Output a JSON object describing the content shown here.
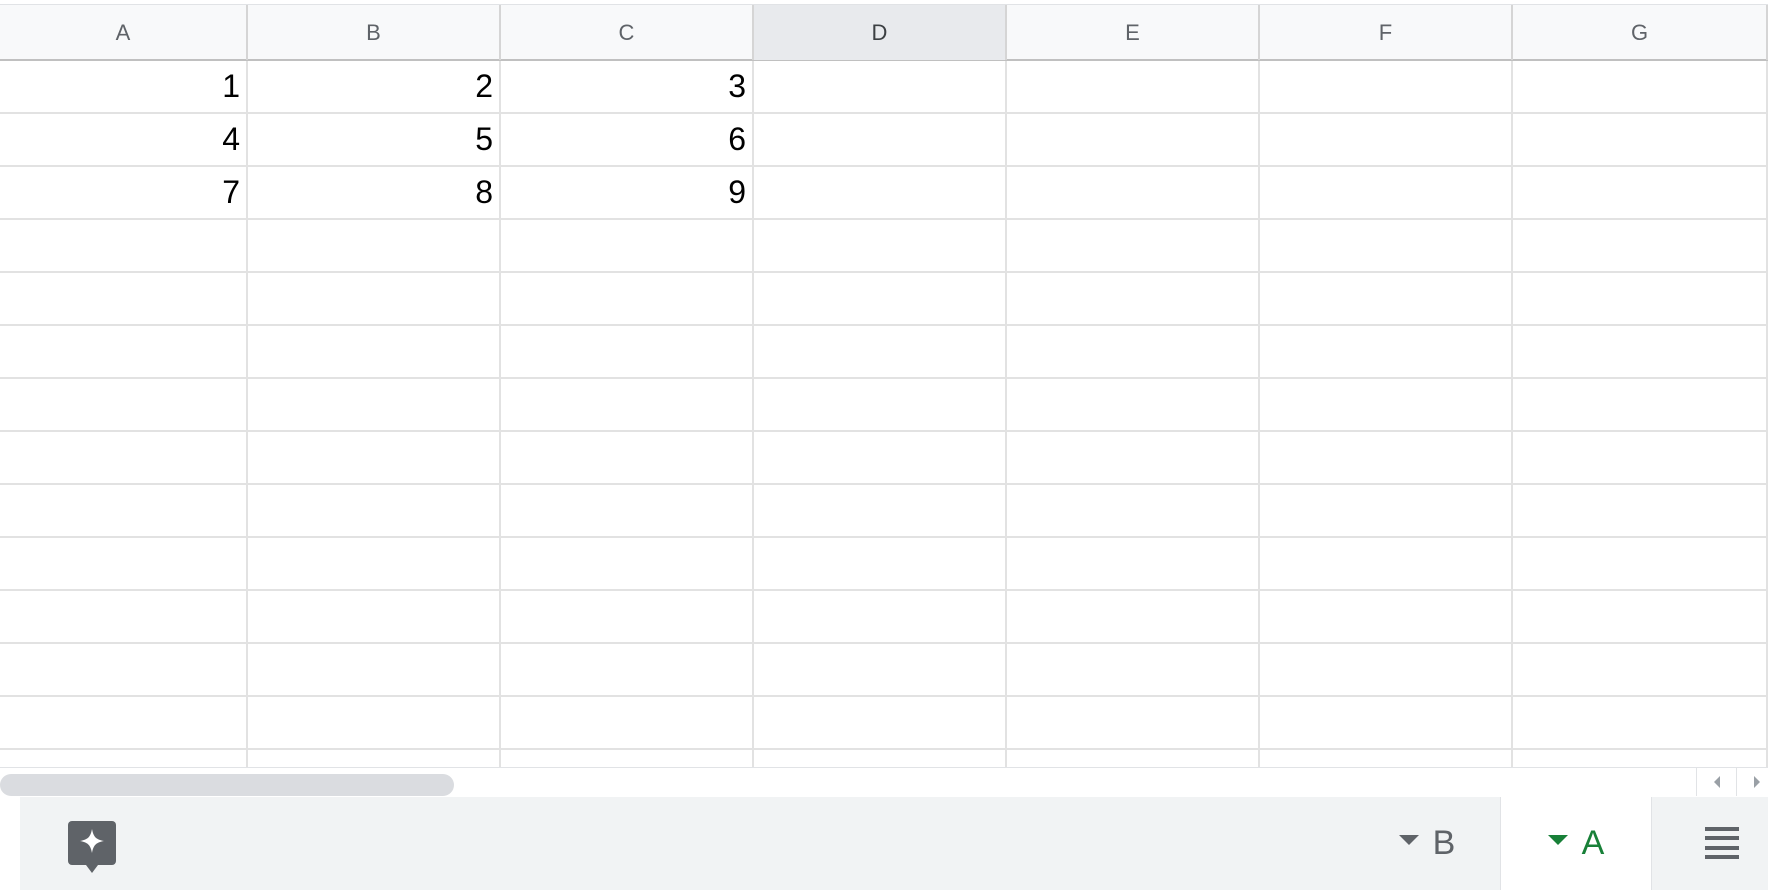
{
  "columns": [
    "A",
    "B",
    "C",
    "D",
    "E",
    "F",
    "G"
  ],
  "selected_column": "D",
  "rows": [
    [
      "1",
      "2",
      "3",
      "",
      "",
      "",
      ""
    ],
    [
      "4",
      "5",
      "6",
      "",
      "",
      "",
      ""
    ],
    [
      "7",
      "8",
      "9",
      "",
      "",
      "",
      ""
    ],
    [
      "",
      "",
      "",
      "",
      "",
      "",
      ""
    ],
    [
      "",
      "",
      "",
      "",
      "",
      "",
      ""
    ],
    [
      "",
      "",
      "",
      "",
      "",
      "",
      ""
    ],
    [
      "",
      "",
      "",
      "",
      "",
      "",
      ""
    ],
    [
      "",
      "",
      "",
      "",
      "",
      "",
      ""
    ],
    [
      "",
      "",
      "",
      "",
      "",
      "",
      ""
    ],
    [
      "",
      "",
      "",
      "",
      "",
      "",
      ""
    ],
    [
      "",
      "",
      "",
      "",
      "",
      "",
      ""
    ],
    [
      "",
      "",
      "",
      "",
      "",
      "",
      ""
    ],
    [
      "",
      "",
      "",
      "",
      "",
      "",
      ""
    ],
    [
      "",
      "",
      "",
      "",
      "",
      "",
      ""
    ]
  ],
  "sheet_tabs": [
    {
      "label": "B",
      "active": false
    },
    {
      "label": "A",
      "active": true
    }
  ],
  "icons": {
    "explore": "explore-sparkle-icon",
    "all_sheets": "all-sheets-list-icon",
    "scroll_left": "scroll-left-arrow-icon",
    "scroll_right": "scroll-right-arrow-icon",
    "tab_menu": "caret-down-icon"
  },
  "colors": {
    "active_tab_text": "#188038",
    "inactive_tab_text": "#5f6368",
    "header_bg": "#f8f9fa",
    "selected_header_bg": "#e8eaed",
    "sheet_bar_bg": "#f1f3f4"
  }
}
